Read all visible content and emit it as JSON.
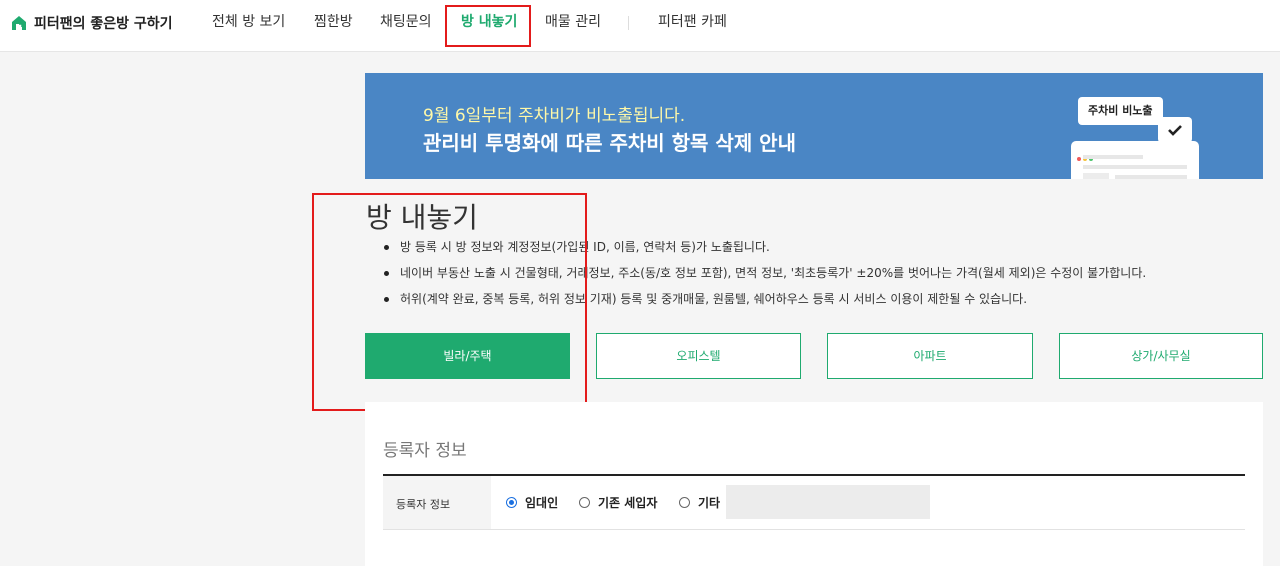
{
  "nav": {
    "brand": "피터팬의 좋은방 구하기",
    "items": [
      {
        "label": "전체 방 보기"
      },
      {
        "label": "찜한방"
      },
      {
        "label": "채팅문의"
      },
      {
        "label": "방 내놓기",
        "active": true
      },
      {
        "label": "매물 관리"
      },
      {
        "label": "피터팬 카페"
      }
    ]
  },
  "banner": {
    "subtitle": "9월 6일부터 주차비가 비노출됩니다.",
    "title": "관리비 투명화에 따른 주차비 항목 삭제 안내",
    "bubble": "주차비 비노출"
  },
  "page": {
    "title": "방 내놓기",
    "notices": [
      "방 등록 시 방 정보와 계정정보(가입된 ID, 이름, 연락처 등)가 노출됩니다.",
      "네이버 부동산 노출 시 건물형태, 거래정보, 주소(동/호 정보 포함), 면적 정보, '최초등록가' ±20%를 벗어나는 가격(월세 제외)은 수정이 불가합니다.",
      "허위(계약 완료, 중복 등록, 허위 정보 기재) 등록 및 중개매물, 원룸텔, 쉐어하우스 등록 시 서비스 이용이 제한될 수 있습니다."
    ],
    "types": [
      {
        "label": "빌라/주택",
        "active": true
      },
      {
        "label": "오피스텔"
      },
      {
        "label": "아파트"
      },
      {
        "label": "상가/사무실"
      }
    ]
  },
  "form": {
    "section_title": "등록자 정보",
    "row_label": "등록자 정보",
    "options": [
      {
        "label": "임대인",
        "checked": true
      },
      {
        "label": "기존 세입자"
      },
      {
        "label": "기타"
      }
    ],
    "etc_value": ""
  },
  "colors": {
    "brand_green": "#1faa6f",
    "banner_blue": "#4a86c5",
    "highlight_red": "#e31b1b"
  }
}
